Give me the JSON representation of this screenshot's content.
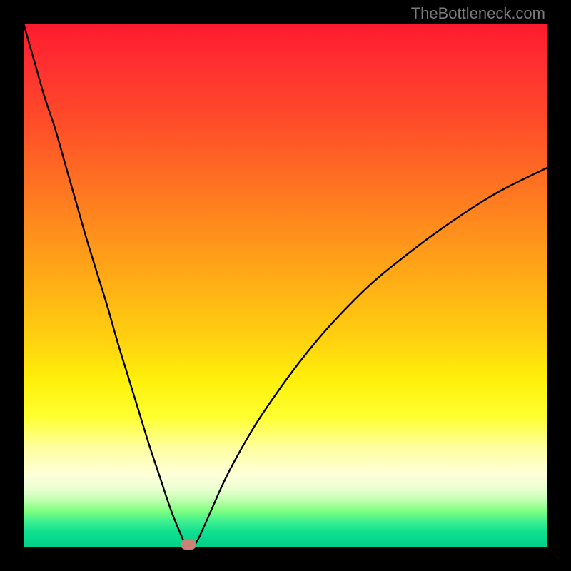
{
  "attribution": "TheBottleneck.com",
  "colors": {
    "curve": "#000000",
    "marker": "#cb8277",
    "plot_top": "#ff1a2e",
    "plot_bottom": "#00d088"
  },
  "chart_data": {
    "type": "line",
    "title": "",
    "xlabel": "",
    "ylabel": "",
    "xlim": [
      0,
      100
    ],
    "ylim": [
      0,
      100
    ],
    "series": [
      {
        "name": "bottleneck-curve",
        "x": [
          0,
          2,
          4,
          6,
          8,
          10,
          12,
          14,
          16,
          18,
          20,
          22,
          24,
          26,
          28,
          30,
          31,
          32,
          33,
          34,
          36,
          38,
          40,
          44,
          48,
          52,
          56,
          60,
          66,
          72,
          80,
          90,
          100
        ],
        "y": [
          100,
          93,
          86,
          80,
          73,
          66,
          59,
          52.5,
          46,
          39,
          32.5,
          26,
          19.5,
          13.5,
          7.5,
          2.5,
          0.5,
          0,
          1,
          3,
          7.5,
          12,
          16,
          23,
          29,
          34.5,
          39.5,
          44,
          50,
          55,
          61,
          67.5,
          72.5
        ]
      }
    ],
    "marker": {
      "x": 31.5,
      "y": 0.5
    },
    "gradient_stops": [
      {
        "pos": 0,
        "color": "#ff1a2e"
      },
      {
        "pos": 50,
        "color": "#ffb015"
      },
      {
        "pos": 75,
        "color": "#ffff30"
      },
      {
        "pos": 100,
        "color": "#00d088"
      }
    ]
  }
}
